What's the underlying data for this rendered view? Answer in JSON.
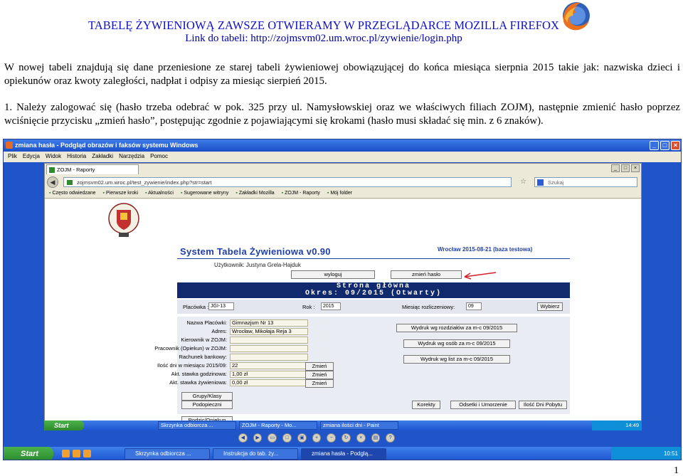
{
  "document": {
    "title": "TABELĘ ŻYWIENIOWĄ ZAWSZE OTWIERAMY W PRZEGLĄDARCE MOZILLA FIREFOX",
    "link_line": "Link do tabeli: http://zojmsvm02.um.wroc.pl/zywienie/login.php",
    "paragraph1": "W nowej tabeli znajdują się dane przeniesione ze starej tabeli żywieniowej obowiązującej do końca miesiąca sierpnia 2015 takie jak: nazwiska dzieci i opiekunów oraz kwoty zaległości, nadpłat i odpisy za miesiąc sierpień 2015.",
    "paragraph2": "1. Należy zalogować się (hasło trzeba odebrać w pok. 325 przy ul. Namysłowskiej oraz we właściwych filiach ZOJM), następnie zmienić hasło poprzez wciśnięcie przycisku „zmień hasło”, postępując zgodnie z pojawiającymi się krokami (hasło musi składać się min. z 6 znaków).",
    "page_number": "1"
  },
  "screenshot": {
    "outer_window_title": "zmiana hasła - Podgląd obrazów i faksów systemu Windows",
    "outer_menu": [
      "Plik",
      "Edycja",
      "Widok",
      "Historia",
      "Zakładki",
      "Narzędzia",
      "Pomoc"
    ],
    "browser_tab": "ZOJM - Raporty",
    "url": "zojmsvm02.um.wroc.pl/test_zywienie/index.php?str=start",
    "search_placeholder": "Szukaj",
    "bookmarks": [
      "Często odwiedzane",
      "Pierwsze kroki",
      "Aktualności",
      "Sugerowane witryny",
      "Zakładki Mozilla",
      "ZOJM - Raporty",
      "Mój folder"
    ],
    "app_title": "System Tabela Żywieniowa v0.90",
    "app_date": "Wrocław 2015-08-21 (baza testowa)",
    "user_label": "Użytkownik: Justyna Grela-Hajduk",
    "logout_button": "wyloguj",
    "change_password_button": "zmień hasło",
    "nav_line1": "Strona główna",
    "nav_line2": "Okres: 09/2015 (Otwarty)",
    "filter": {
      "placowka_label": "Placówka :",
      "placowka_value": "JGI-13",
      "rok_label": "Rok :",
      "rok_value": "2015",
      "miesiac_label": "Miesiąc rozliczeniowy:",
      "miesiac_value": "09",
      "button": "Wybierz"
    },
    "info_rows": [
      {
        "label": "Nazwa Placówki:",
        "value": "Gimnazjum Nr 13"
      },
      {
        "label": "Adres:",
        "value": "Wrocław, Mikołaja Reja 3"
      },
      {
        "label": "Kierownik w ZOJM:",
        "value": ""
      },
      {
        "label": "Pracownik (Opiekun) w ZOJM:",
        "value": ""
      },
      {
        "label": "Rachunek bankowy:",
        "value": ""
      },
      {
        "label": "Ilość dni w miesiącu 2015/09:",
        "value": "22"
      },
      {
        "label": "Akt. stawka godzinowa:",
        "value": "1,00 zł"
      },
      {
        "label": "Akt. stawka żywieniowa:",
        "value": "0,00 zł"
      }
    ],
    "zmien_label": "Zmień",
    "report_buttons": [
      "Wydruk wg rozdziałów za m-c 09/2015",
      "Wydruk wg osób za m-c 09/2015",
      "Wydruk wg list za m-c 09/2015"
    ],
    "bottom_buttons": [
      "Grupy/Klasy",
      "Podopieczni",
      "Rodzic/Opiekun",
      "Korekty",
      "Odsetki i Umorzenie",
      "Ilość Dni Pobytu"
    ],
    "inner_taskbar": {
      "start": "Start",
      "tasks": [
        "Skrzynka odbiorcza ...",
        "ZOJM - Raporty - Mo...",
        "zmiana ilości dni - Paint"
      ],
      "clock": "14:49"
    },
    "outer_taskbar": {
      "start": "Start",
      "tasks": [
        "Skrzynka odbiorcza ...",
        "Instrukcja do tab. ży...",
        "zmiana hasła - Podglą..."
      ],
      "clock": "10:51"
    }
  }
}
